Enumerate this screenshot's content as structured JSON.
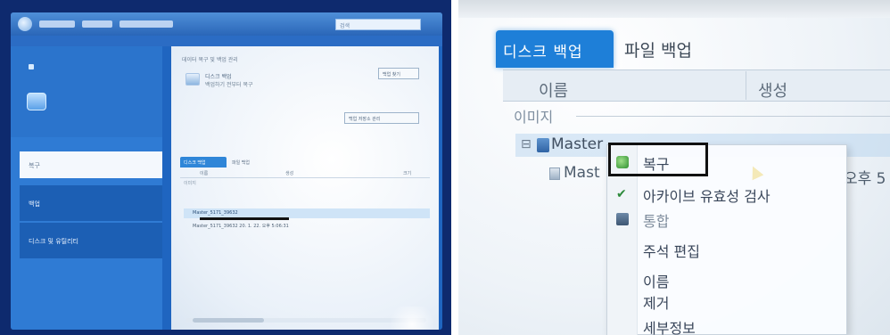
{
  "left_screenshot": {
    "window": {
      "search_placeholder": "검색"
    },
    "sidebar": {
      "items": [
        {
          "label": "복구"
        },
        {
          "label": "백업"
        },
        {
          "label": "디스크 및 유틸리티"
        }
      ]
    },
    "main": {
      "heading": "데이터 복구 및 백업 관리",
      "disk_title": "디스크 백업",
      "disk_subtitle": "백업하기 전부터 복구",
      "button_a": "백업 찾기",
      "button_b": "백업 저장소 관리",
      "tabs": [
        {
          "label": "디스크 백업",
          "active": true
        },
        {
          "label": "파일 백업",
          "active": false
        }
      ],
      "columns": [
        "이름",
        "생성",
        "크기"
      ],
      "section_label": "이미지",
      "master_row": "Master_5171_39632",
      "child_row": "Master_5171_39632 20. 1. 22. 오후 5:06:31"
    }
  },
  "right_screenshot": {
    "tabs": [
      {
        "label": "디스크 백업",
        "active": true
      },
      {
        "label": "파일 백업",
        "active": false
      }
    ],
    "columns": {
      "name": "이름",
      "created": "생성"
    },
    "section_label": "이미지",
    "master_row": "Master",
    "child_row": "Mast",
    "time_text": "오후 5",
    "context_menu": {
      "items": [
        {
          "label": "복구",
          "highlighted": true
        },
        {
          "label": "아카이브 유효성 검사"
        },
        {
          "label": "통합"
        },
        {
          "label": "주석 편집"
        },
        {
          "label": "이름"
        },
        {
          "label": "제거"
        },
        {
          "label": "세부정보"
        }
      ]
    }
  }
}
